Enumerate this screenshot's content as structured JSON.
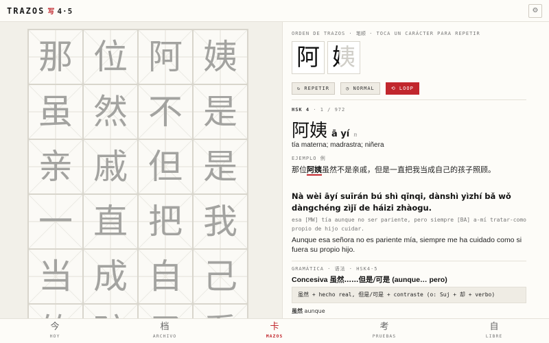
{
  "app": {
    "brand": "TRAZOS",
    "brand_mark": "写",
    "version": "4·5",
    "settings_icon": "gear-icon"
  },
  "grid": {
    "characters": [
      "那",
      "位",
      "阿",
      "姨",
      "虽",
      "然",
      "不",
      "是",
      "亲",
      "戚",
      "但",
      "是",
      "一",
      "直",
      "把",
      "我",
      "当",
      "成",
      "自",
      "己",
      "的",
      "孩",
      "子",
      "看"
    ]
  },
  "stroke": {
    "header_prefix": "ORDEN DE TRAZOS ·",
    "header_zh": "笔顺",
    "header_suffix": "· TOCA UN CARÁCTER PARA REPETIR",
    "tiles": [
      "阿",
      "姨"
    ],
    "buttons": {
      "repeat": "↻ REPETIR",
      "normal": "◷ NORMAL",
      "loop": "⟲ LOOP"
    }
  },
  "word": {
    "hsk": "HSK 4",
    "counter": "· 1 / 972",
    "hanzi": "阿姨",
    "pinyin": "ā yí",
    "pos": "n",
    "meaning": "tía materna; madrastra; niñera"
  },
  "example": {
    "label_prefix": "EJEMPLO",
    "label_zh": "例",
    "zh_before": "那位",
    "zh_highlight": "阿姨",
    "zh_after": "虽然不是亲戚，但是一直把我当成自己的孩子照顾。",
    "pinyin": "Nà wèi āyí suīrán bú shì qīnqi, dànshì yìzhí bǎ wǒ dàngchéng zìjǐ de háizi zhàogu.",
    "gloss": "esa [MW] tía aunque no ser pariente, pero siempre [BA] a-mí tratar-como propio de hijo cuidar.",
    "spanish": "Aunque esa señora no es pariente mía, siempre me ha cuidado como si fuera su propio hijo."
  },
  "grammar": {
    "label": "GRAMÁTICA · 语法 · HSK4-5",
    "title_es": "Concesiva",
    "title_zh": "虽然……但是/可是",
    "title_paren": "(aunque… pero)",
    "formula": "虽然 + hecho real, 但是/可是 + contraste (o: Suj + 却 + verbo)",
    "aunque_zh": "虽然",
    "aunque_es": "aunque"
  },
  "nav": {
    "items": [
      {
        "icon": "今",
        "label": "HOY"
      },
      {
        "icon": "档",
        "label": "ARCHIVO"
      },
      {
        "icon": "卡",
        "label": "MAZOS"
      },
      {
        "icon": "考",
        "label": "PRUEBAS"
      },
      {
        "icon": "自",
        "label": "LIBRE"
      }
    ]
  },
  "colors": {
    "accent": "#c1272d",
    "background": "#f6f4ee",
    "panel": "#fdfcf8"
  }
}
